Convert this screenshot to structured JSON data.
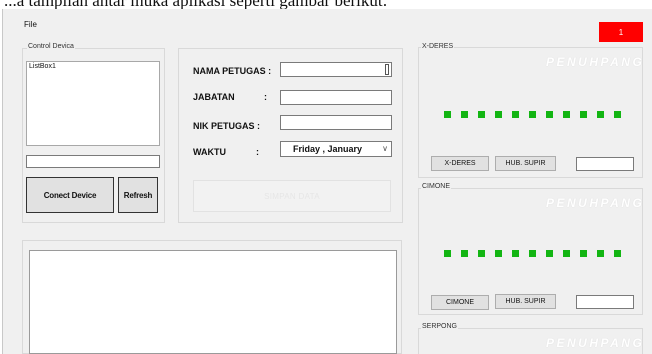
{
  "caption": "...a tampilan antar muka aplikasi seperti gambar berikut:",
  "menu": {
    "file_label": "File"
  },
  "indicator": {
    "value": "1",
    "color": "#ff0000"
  },
  "control_device": {
    "legend": "Control Devica",
    "listbox_item": "ListBox1",
    "status_value": "",
    "connect_label": "Conect Device",
    "refresh_label": "Refresh"
  },
  "form": {
    "nama_label": "NAMA PETUGAS :",
    "nama_value": "",
    "jabatan_label": "JABATAN",
    "jabatan_colon": ":",
    "jabatan_value": "",
    "nik_label": "NIK PETUGAS  :",
    "nik_value": "",
    "waktu_label": "WAKTU",
    "waktu_colon": ":",
    "waktu_value": "Friday   ,  January",
    "simpan_label": "SIMPAN DATA"
  },
  "log_area": {
    "value": ""
  },
  "stations": [
    {
      "name": "X-DERES",
      "watermark": "PENUHPANG",
      "led_count": 11,
      "led_color": "#13b513",
      "button_label": "X-DERES",
      "supir_label": "HUB. SUPIR",
      "value": ""
    },
    {
      "name": "CIMONE",
      "watermark": "PENUHPANG",
      "led_count": 11,
      "led_color": "#13b513",
      "button_label": "CIMONE",
      "supir_label": "HUB. SUPIR",
      "value": ""
    },
    {
      "name": "SERPONG",
      "watermark": "PENUHPANG"
    }
  ]
}
